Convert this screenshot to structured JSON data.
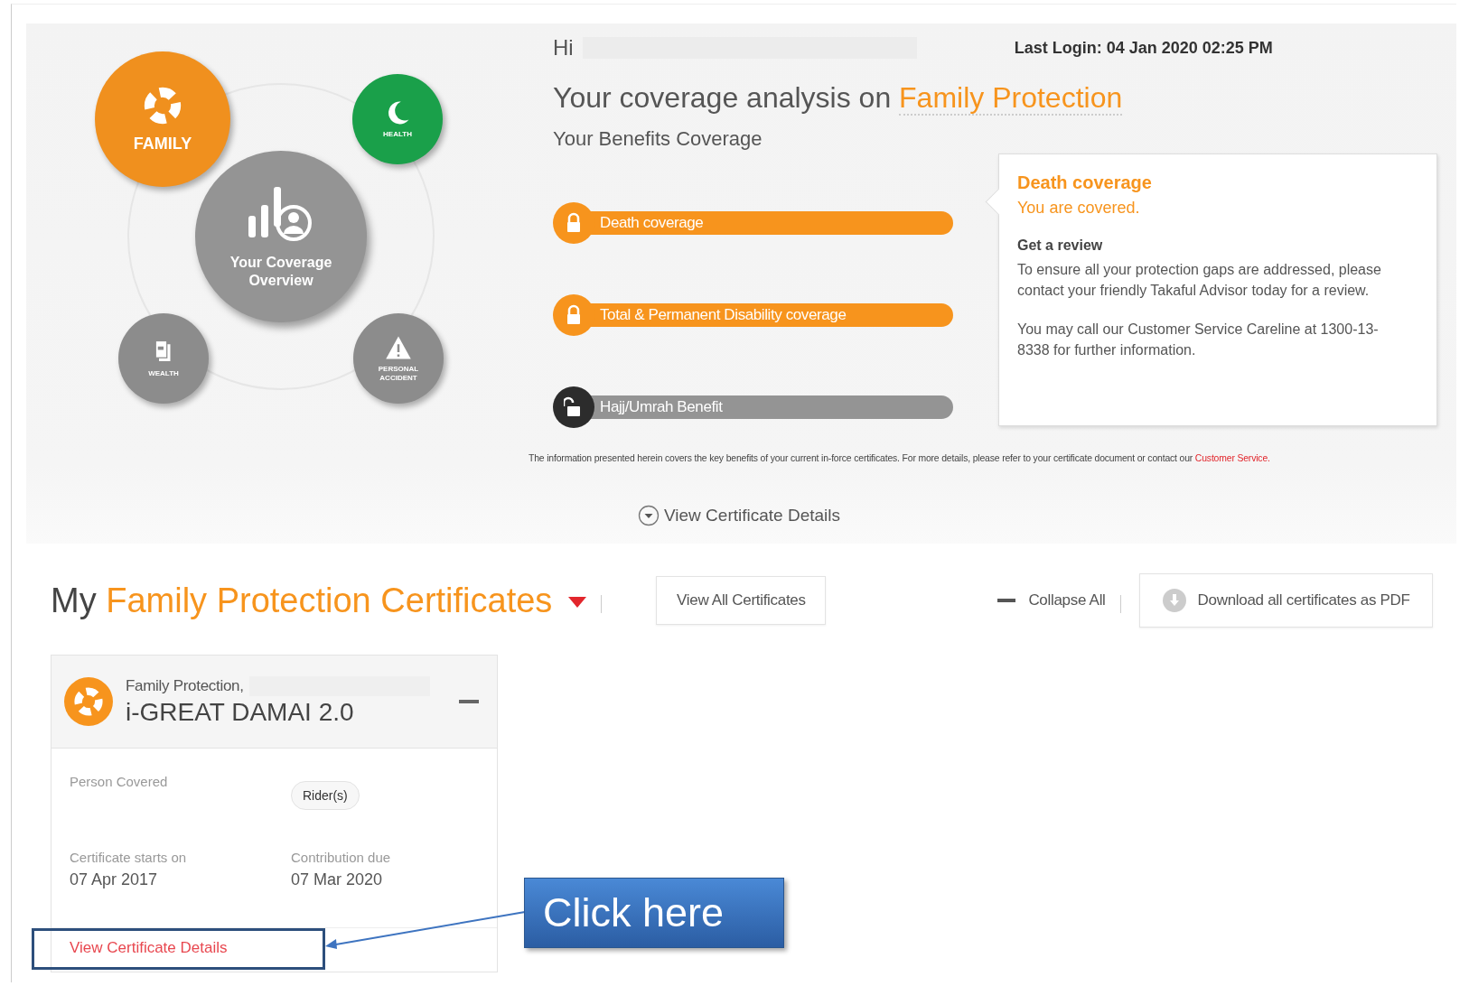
{
  "greeting": {
    "hi": "Hi",
    "last_login": "Last Login: 04 Jan 2020 02:25 PM"
  },
  "categories": [
    {
      "kind": "family",
      "label": "FAMILY",
      "selected": true,
      "color": "#f0901e"
    },
    {
      "kind": "health",
      "label": "HEALTH",
      "selected": false,
      "color": "#1aa04a"
    },
    {
      "kind": "wealth",
      "label": "WEALTH",
      "selected": false,
      "color": "#8c8c8c"
    },
    {
      "kind": "accident",
      "label": "PERSONAL ACCIDENT",
      "selected": false,
      "color": "#8c8c8c"
    }
  ],
  "overview": {
    "label": "Your Coverage Overview"
  },
  "analysis": {
    "title_prefix": "Your coverage analysis on",
    "title_highlight": "Family Protection",
    "subtitle": "Your Benefits Coverage"
  },
  "benefits": [
    {
      "label": "Death coverage",
      "covered": true
    },
    {
      "label": "Total & Permanent Disability coverage",
      "covered": true
    },
    {
      "label": "Hajj/Umrah Benefit",
      "covered": false
    }
  ],
  "popup": {
    "title": "Death coverage",
    "status": "You are covered.",
    "subheading": "Get a review",
    "paragraphs": [
      "To ensure all your protection gaps are addressed, please contact your friendly Takaful Advisor today for a review.",
      "You may call our Customer Service Careline at 1300-13-8338 for further information."
    ]
  },
  "footnote": {
    "text": "The information presented herein covers the key benefits of your current in-force certificates. For more details, please refer to your certificate document or contact our",
    "link": "Customer Service."
  },
  "view_details_toggle": "View Certificate Details",
  "certificates": {
    "title_prefix": "My",
    "title_highlight": "Family Protection Certificates",
    "view_all": "View All Certificates",
    "collapse_all": "Collapse All",
    "download": "Download all certificates as PDF",
    "card": {
      "category": "Family Protection,",
      "product": "i-GREAT DAMAI 2.0",
      "expanded": true,
      "person_label": "Person Covered",
      "rider": "Rider(s)",
      "start_label": "Certificate starts on",
      "start_value": "07 Apr 2017",
      "due_label": "Contribution due",
      "due_value": "07 Mar 2020",
      "link": "View Certificate Details"
    }
  },
  "annotation": {
    "callout": "Click here"
  }
}
